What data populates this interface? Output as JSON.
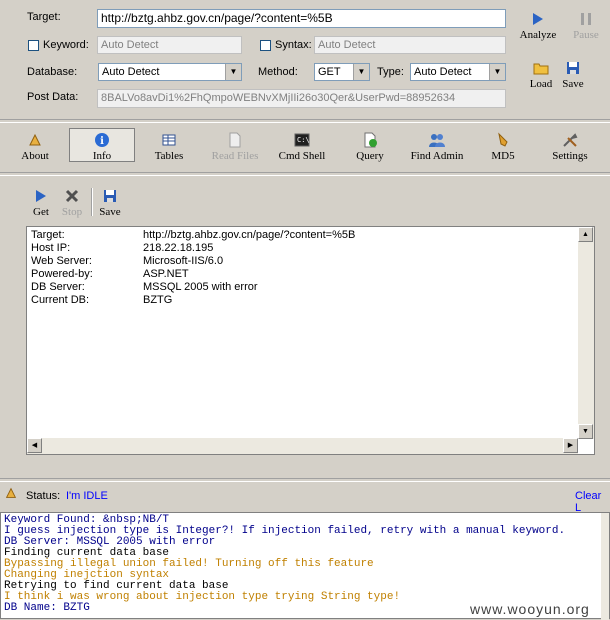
{
  "form": {
    "target_label": "Target:",
    "target_value": "http://bztg.ahbz.gov.cn/page/?content=%5B",
    "keyword_label": "Keyword:",
    "keyword_placeholder": "Auto Detect",
    "syntax_label": "Syntax:",
    "syntax_placeholder": "Auto Detect",
    "database_label": "Database:",
    "database_value": "Auto Detect",
    "method_label": "Method:",
    "method_value": "GET",
    "type_label": "Type:",
    "type_value": "Auto Detect",
    "postdata_label": "Post Data:",
    "postdata_value": "8BALVo8avDi1%2FhQmpoWEBNvXMjIIi26o30Qer&UserPwd=88952634"
  },
  "actions": {
    "analyze": "Analyze",
    "pause": "Pause",
    "load": "Load",
    "save": "Save"
  },
  "toolbar": {
    "about": "About",
    "info": "Info",
    "tables": "Tables",
    "read_files": "Read Files",
    "cmd_shell": "Cmd Shell",
    "query": "Query",
    "find_admin": "Find Admin",
    "md5": "MD5",
    "settings": "Settings"
  },
  "subtoolbar": {
    "get": "Get",
    "stop": "Stop",
    "save": "Save"
  },
  "info": [
    {
      "key": "Target:",
      "value": "http://bztg.ahbz.gov.cn/page/?content=%5B"
    },
    {
      "key": "Host IP:",
      "value": "218.22.18.195"
    },
    {
      "key": "Web Server:",
      "value": "Microsoft-IIS/6.0"
    },
    {
      "key": "Powered-by:",
      "value": "ASP.NET"
    },
    {
      "key": "DB Server:",
      "value": "MSSQL 2005 with error"
    },
    {
      "key": "Current DB:",
      "value": "BZTG"
    }
  ],
  "status": {
    "label": "Status:",
    "value": "I'm IDLE",
    "clear_log": "Clear L"
  },
  "log": [
    {
      "text": "Keyword Found: &nbsp;NB/T",
      "color": "#00008b"
    },
    {
      "text": "I guess injection type is Integer?! If injection failed, retry with a manual keyword.",
      "color": "#00008b"
    },
    {
      "text": "DB Server: MSSQL 2005 with error",
      "color": "#00008b"
    },
    {
      "text": "Finding current data base",
      "color": "#000000"
    },
    {
      "text": "Bypassing illegal union failed! Turning off this feature",
      "color": "#c08000"
    },
    {
      "text": "Changing inejction syntax",
      "color": "#c08000"
    },
    {
      "text": "Retrying to find current data base",
      "color": "#000000"
    },
    {
      "text": "I think i was wrong about injection type trying String type!",
      "color": "#c08000"
    },
    {
      "text": "DB Name: BZTG",
      "color": "#00008b"
    }
  ],
  "watermark": "www.wooyun.org",
  "colors": {
    "status_value": "#0000ff",
    "log_blue": "#00008b",
    "log_orange": "#c08000"
  }
}
